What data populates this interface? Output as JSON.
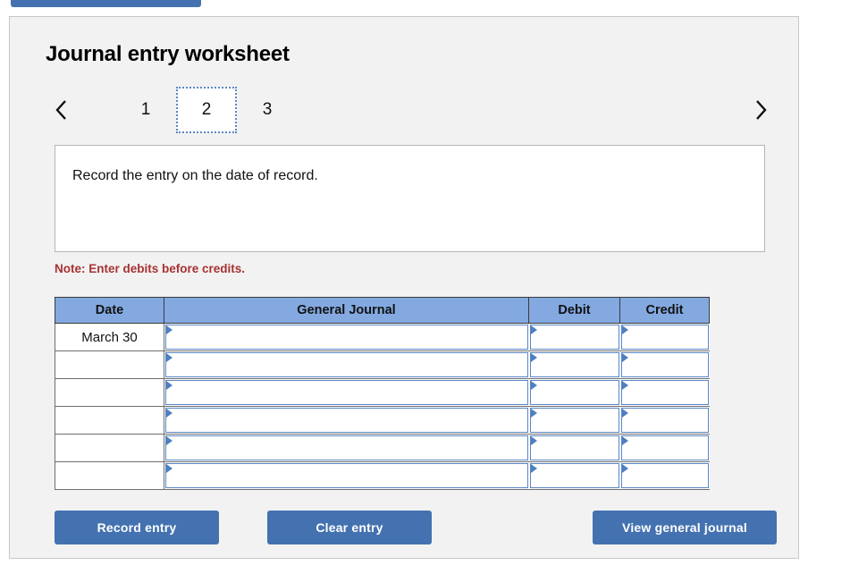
{
  "top_bar": {
    "label": ""
  },
  "panel": {
    "title": "Journal entry worksheet",
    "nav": {
      "prev_icon": "chevron-left-icon",
      "next_icon": "chevron-right-icon"
    },
    "tabs": [
      {
        "label": "1",
        "selected": false
      },
      {
        "label": "2",
        "selected": true
      },
      {
        "label": "3",
        "selected": false
      }
    ],
    "description": "Record the entry on the date of record.",
    "note": "Note: Enter debits before credits.",
    "table": {
      "columns": [
        "Date",
        "General Journal",
        "Debit",
        "Credit"
      ],
      "rows": [
        {
          "date": "March 30",
          "general_journal": "",
          "debit": "",
          "credit": ""
        },
        {
          "date": "",
          "general_journal": "",
          "debit": "",
          "credit": ""
        },
        {
          "date": "",
          "general_journal": "",
          "debit": "",
          "credit": ""
        },
        {
          "date": "",
          "general_journal": "",
          "debit": "",
          "credit": ""
        },
        {
          "date": "",
          "general_journal": "",
          "debit": "",
          "credit": ""
        },
        {
          "date": "",
          "general_journal": "",
          "debit": "",
          "credit": ""
        }
      ]
    },
    "buttons": {
      "record": "Record entry",
      "clear": "Clear entry",
      "view": "View general journal"
    }
  },
  "colors": {
    "accent_blue": "#4472b0",
    "header_blue": "#83a9e0",
    "field_border": "#5a86c4",
    "note_red": "#a83232",
    "panel_bg": "#f2f2f2"
  }
}
